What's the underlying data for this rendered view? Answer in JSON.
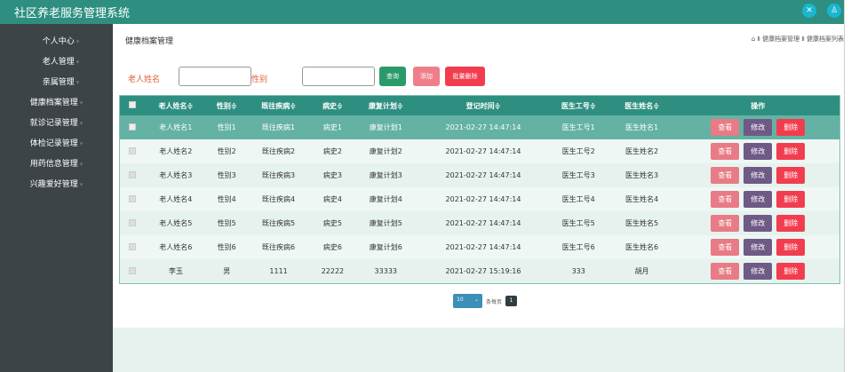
{
  "app": {
    "title": "社区养老服务管理系统",
    "icons": [
      "fullscreen-icon",
      "user-icon"
    ]
  },
  "sidebar": {
    "items": [
      {
        "label": "个人中心"
      },
      {
        "label": "老人管理"
      },
      {
        "label": "亲属管理"
      },
      {
        "label": "健康档案管理"
      },
      {
        "label": "就诊记录管理"
      },
      {
        "label": "体检记录管理"
      },
      {
        "label": "用药信息管理"
      },
      {
        "label": "兴趣爱好管理"
      }
    ]
  },
  "page": {
    "title": "健康档案管理",
    "breadcrumb": "Ⅱ 健康档案管理 Ⅱ 健康档案列表"
  },
  "search": {
    "name_label": "老人姓名",
    "name_value": "",
    "sex_label": "性别",
    "sex_value": "",
    "query": "查询",
    "add": "添加",
    "batch_delete": "批量删除"
  },
  "table": {
    "headers": [
      "老人姓名≑",
      "性别≑",
      "既往疾病≑",
      "病史≑",
      "康复计划≑",
      "登记时间≑",
      "医生工号≑",
      "医生姓名≑",
      "操作"
    ],
    "actions": {
      "view": "查看",
      "edit": "修改",
      "delete": "删除"
    },
    "rows": [
      [
        "老人姓名1",
        "性别1",
        "既往疾病1",
        "病史1",
        "康复计划1",
        "2021-02-27 14:47:14",
        "医生工号1",
        "医生姓名1"
      ],
      [
        "老人姓名2",
        "性别2",
        "既往疾病2",
        "病史2",
        "康复计划2",
        "2021-02-27 14:47:14",
        "医生工号2",
        "医生姓名2"
      ],
      [
        "老人姓名3",
        "性别3",
        "既往疾病3",
        "病史3",
        "康复计划3",
        "2021-02-27 14:47:14",
        "医生工号3",
        "医生姓名3"
      ],
      [
        "老人姓名4",
        "性别4",
        "既往疾病4",
        "病史4",
        "康复计划4",
        "2021-02-27 14:47:14",
        "医生工号4",
        "医生姓名4"
      ],
      [
        "老人姓名5",
        "性别5",
        "既往疾病5",
        "病史5",
        "康复计划5",
        "2021-02-27 14:47:14",
        "医生工号5",
        "医生姓名5"
      ],
      [
        "老人姓名6",
        "性别6",
        "既往疾病6",
        "病史6",
        "康复计划6",
        "2021-02-27 14:47:14",
        "医生工号6",
        "医生姓名6"
      ],
      [
        "李玉",
        "男",
        "1111",
        "22222",
        "33333",
        "2021-02-27 15:19:16",
        "333",
        "胡月"
      ]
    ]
  },
  "pager": {
    "page_size": "10",
    "per_page_label": "条每页",
    "current_page": "1"
  },
  "colors": {
    "header": "#2e8f81",
    "sidebar": "#3d4447",
    "query": "#2a9a6a",
    "add": "#ee7f8a",
    "delete": "#f23d4f",
    "edit": "#6f5a86"
  }
}
